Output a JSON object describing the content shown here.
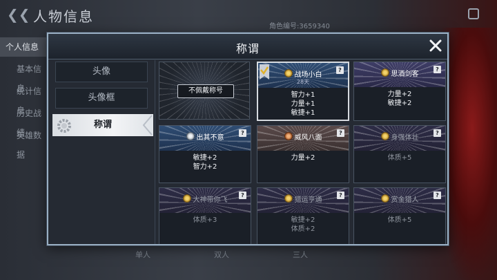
{
  "background": {
    "page_title": "人物信息",
    "sub_text": "角色编号:3659340",
    "side_items": [
      "个人信息",
      "基本信息",
      "统计信息",
      "历史战绩",
      "英雄数据"
    ],
    "bottom_labels": [
      "单人",
      "双人",
      "三人"
    ]
  },
  "modal": {
    "title": "称谓",
    "close_icon": "close-icon",
    "tabs": [
      {
        "label": "头像",
        "active": false
      },
      {
        "label": "头像框",
        "active": false
      },
      {
        "label": "称谓",
        "active": true
      }
    ],
    "none_option_label": "不佩戴称号",
    "titles": [
      {
        "name": "战场小白",
        "duration": "28天",
        "stats": [
          "智力+1",
          "力量+1",
          "敏捷+1"
        ],
        "equipped": true,
        "state": "active",
        "medal": "gold-medal-icon"
      },
      {
        "name": "思酒剑客",
        "duration": "",
        "stats": [
          "力量+2",
          "敏捷+2"
        ],
        "equipped": false,
        "state": "active",
        "medal": "gold-medal-icon"
      },
      {
        "name": "出其不意",
        "duration": "",
        "stats": [
          "敏捷+2",
          "智力+2"
        ],
        "equipped": false,
        "state": "active",
        "medal": "silver-medal-icon"
      },
      {
        "name": "威风八面",
        "duration": "",
        "stats": [
          "力量+2"
        ],
        "equipped": false,
        "state": "active",
        "medal": "bronze-medal-icon"
      },
      {
        "name": "身强体壮",
        "duration": "",
        "stats": [
          "体质+5"
        ],
        "equipped": false,
        "state": "locked",
        "medal": "gold-medal-icon"
      },
      {
        "name": "大神带你飞",
        "duration": "",
        "stats": [
          "体质+3"
        ],
        "equipped": false,
        "state": "locked",
        "medal": "gold-medal-icon"
      },
      {
        "name": "猎运亨通",
        "duration": "",
        "stats": [
          "敏捷+2",
          "体质+2"
        ],
        "equipped": false,
        "state": "locked",
        "medal": "gold-medal-icon"
      },
      {
        "name": "赏金猎人",
        "duration": "",
        "stats": [
          "体质+5"
        ],
        "equipped": false,
        "state": "locked",
        "medal": "gold-medal-icon"
      }
    ],
    "help_label": "?"
  }
}
